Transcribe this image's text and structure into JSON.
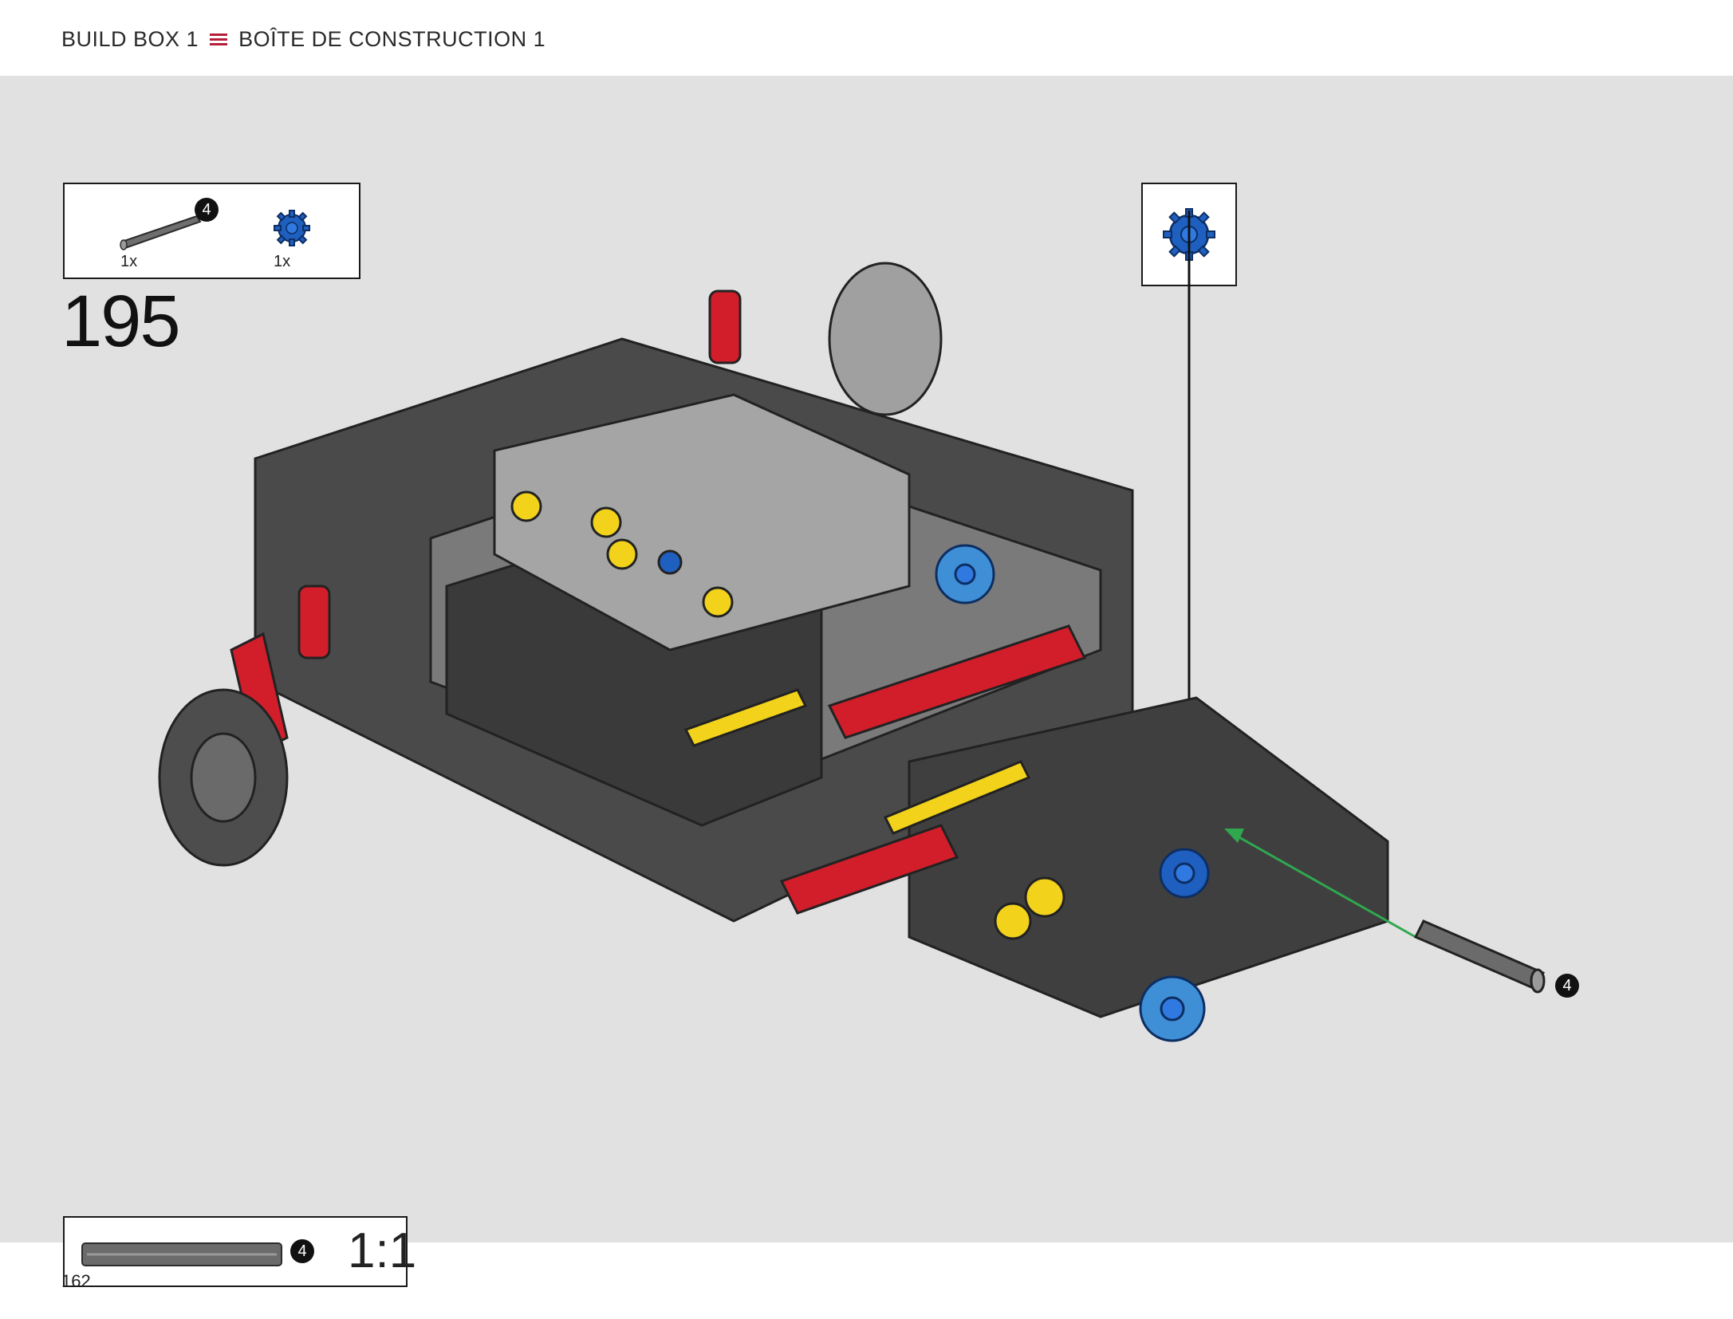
{
  "header": {
    "left_title": "BUILD BOX 1",
    "right_title": "BOÎTE DE CONSTRUCTION 1",
    "menu_icon": "menu-icon"
  },
  "parts_list": {
    "items": [
      {
        "name": "axle",
        "length_badge": "4",
        "quantity": "1x",
        "color": "#6b6b6b"
      },
      {
        "name": "gear",
        "quantity": "1x",
        "color": "#1f5fbf"
      }
    ]
  },
  "step": {
    "number": "195"
  },
  "callout": {
    "item": "gear",
    "color": "#1f5fbf"
  },
  "assembly": {
    "axle_length_badge": "4",
    "arrow_color": "#2fa84f"
  },
  "scale_check": {
    "length_badge": "4",
    "label": "1:1"
  },
  "footer": {
    "page_number": "162"
  }
}
